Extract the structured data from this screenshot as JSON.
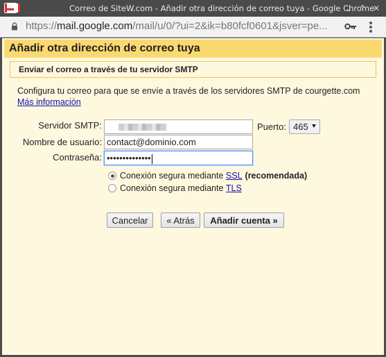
{
  "window": {
    "title": "Correo de SiteW.com - Añadir otra dirección de correo tuya - Google Chrome",
    "minimize_glyph": "⌄",
    "maximize_glyph": "⌃",
    "close_glyph": "✕"
  },
  "urlbar": {
    "scheme": "https://",
    "host": "mail.google.com",
    "path": "/mail/u/0/?ui=2&ik=b80fcf0601&jsver=pe..."
  },
  "dialog": {
    "heading": "Añadir otra dirección de correo tuya",
    "subheading": "Enviar el correo a través de tu servidor SMTP",
    "description": "Configura tu correo para que se envíe a través de los servidores SMTP de courgette.com",
    "more_info_link": "Más información"
  },
  "form": {
    "smtp_label": "Servidor SMTP:",
    "smtp_value": "",
    "port_label": "Puerto:",
    "port_value": "465",
    "username_label": "Nombre de usuario:",
    "username_value": "contact@dominio.com",
    "password_label": "Contraseña:",
    "password_value": "••••••••••••••"
  },
  "security": {
    "option_prefix": "Conexión segura mediante",
    "ssl_link": "SSL",
    "ssl_suffix": "(recomendada)",
    "tls_link": "TLS",
    "selected": "SSL"
  },
  "buttons": {
    "cancel": "Cancelar",
    "back": "« Atrás",
    "add": "Añadir cuenta »"
  }
}
